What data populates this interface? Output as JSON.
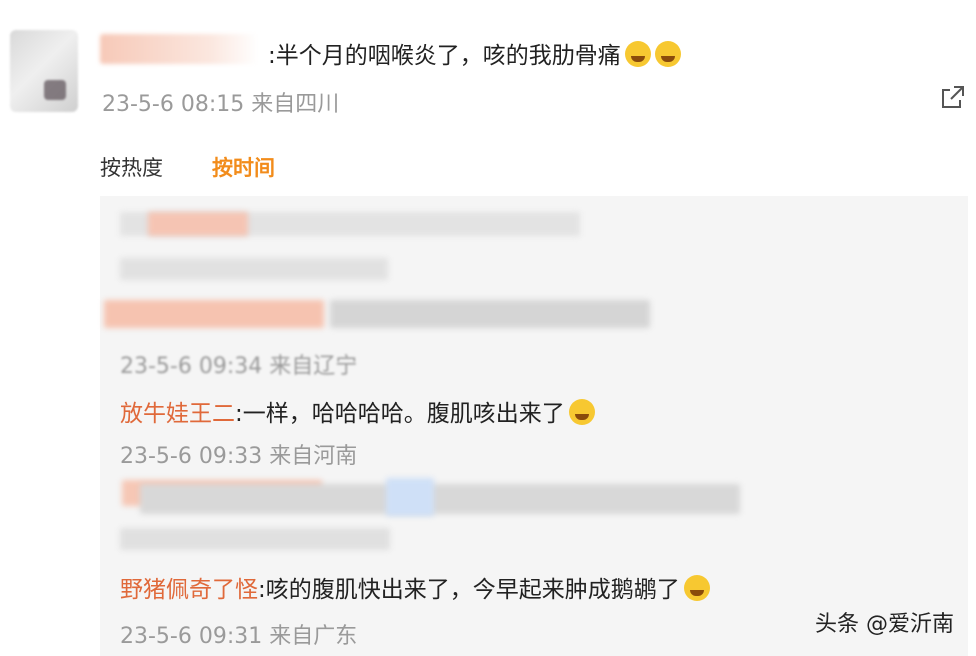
{
  "post": {
    "text": ":半个月的咽喉炎了，咳的我肋骨痛",
    "time": "23-5-6 08:15",
    "source": "来自四川",
    "emojis": [
      "crying-face-icon",
      "crying-face-icon"
    ]
  },
  "sort_tabs": {
    "hot": "按热度",
    "time": "按时间"
  },
  "replies": [
    {
      "user": "放牛娃王二",
      "text": ":一样，哈哈哈哈。腹肌咳出来了",
      "time": "23-5-6 09:33",
      "source": "来自河南"
    },
    {
      "user": "野猪佩奇了怪",
      "text": ":咳的腹肌快出来了，今早起来肿成鹅鹕了",
      "time": "23-5-6 09:31",
      "source": "来自广东"
    }
  ],
  "blurred_reply": {
    "time": "23-5-6 09:34",
    "source": "来自辽宁"
  },
  "watermark": "头条 @爱沂南",
  "colors": {
    "accent": "#f28c1b",
    "username": "#e0693a",
    "meta": "#9a9a9a",
    "panel": "#f5f5f5"
  }
}
